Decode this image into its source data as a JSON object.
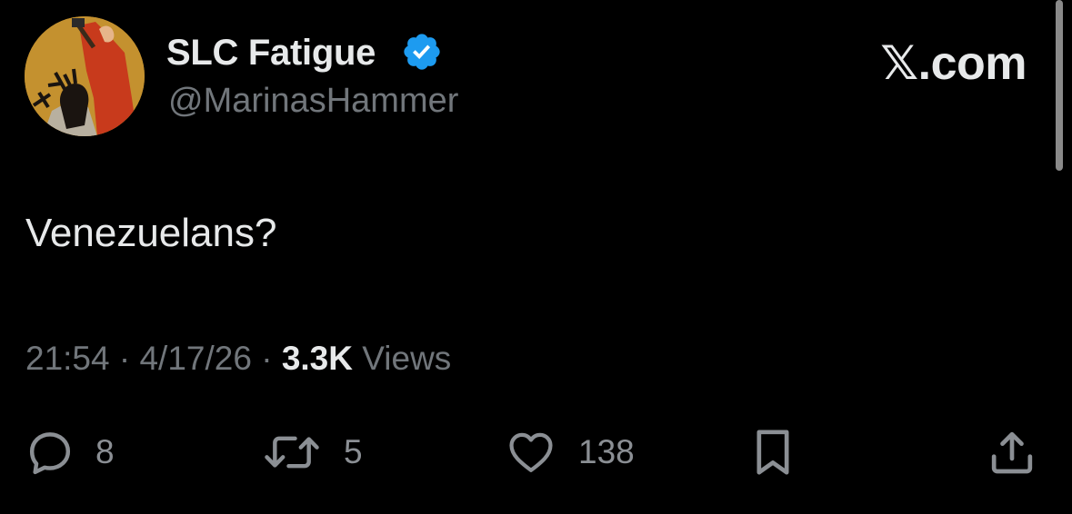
{
  "user": {
    "display_name": "SLC Fatigue",
    "handle": "@MarinasHammer",
    "verified": true
  },
  "brand": "𝕏.com",
  "tweet": {
    "text": "Venezuelans?",
    "time": "21:54",
    "date": "4/17/26",
    "views_count": "3.3K",
    "views_label": "Views"
  },
  "actions": {
    "replies": "8",
    "reposts": "5",
    "likes": "138"
  },
  "colors": {
    "background": "#000000",
    "primary_text": "#e7e9ea",
    "secondary_text": "#71767b",
    "verified_badge": "#1d9bf0"
  }
}
